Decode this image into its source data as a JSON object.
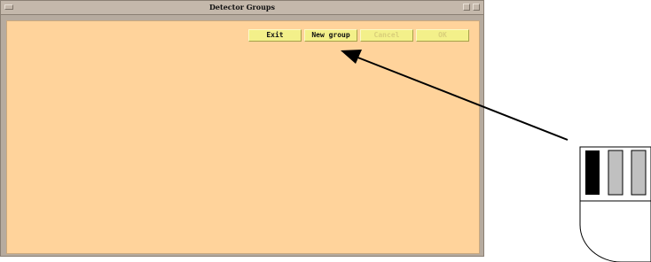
{
  "window": {
    "title": "Detector Groups"
  },
  "toolbar": {
    "exit_label": "Exit",
    "new_group_label": "New group",
    "cancel_label": "Cancel",
    "ok_label": "OK"
  },
  "icons": {
    "window_menu": "window-menu-icon",
    "minimize": "minimize-icon",
    "maximize": "maximize-icon",
    "mouse": "mouse-icon",
    "arrow": "arrow-icon"
  },
  "colors": {
    "panel_background": "#ffd39b",
    "button_background": "#f3f08a",
    "mouse_left_button": "#000000",
    "mouse_other_buttons": "#c0c0c0"
  }
}
